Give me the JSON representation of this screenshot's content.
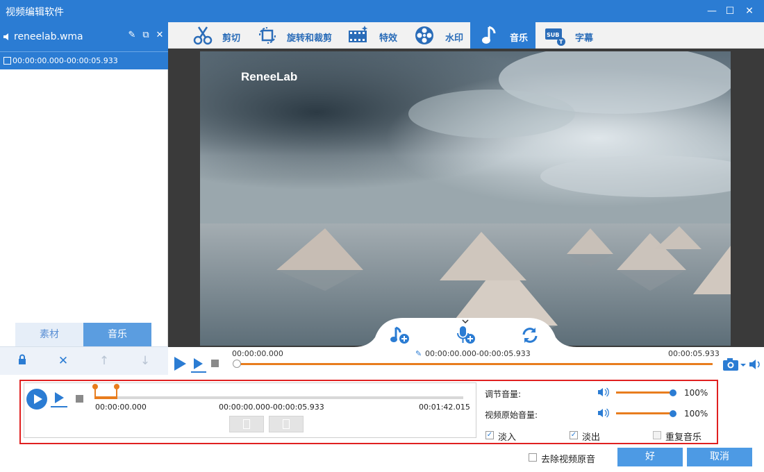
{
  "window": {
    "title": "视频编辑软件"
  },
  "left_panel": {
    "file_name": "reneelab.wma",
    "clip_range": "00:00:00.000-00:00:05.933",
    "tabs": [
      "素材",
      "音乐"
    ]
  },
  "toolbar": {
    "tabs": [
      {
        "label": "剪切",
        "icon": "scissors-icon"
      },
      {
        "label": "旋转和裁剪",
        "icon": "rotate-crop-icon"
      },
      {
        "label": "特效",
        "icon": "effects-icon"
      },
      {
        "label": "水印",
        "icon": "watermark-icon"
      },
      {
        "label": "音乐",
        "icon": "music-icon",
        "active": true
      },
      {
        "label": "字幕",
        "icon": "subtitle-icon"
      }
    ]
  },
  "preview": {
    "watermark_text": "ReneeLab",
    "timeline": {
      "start": "00:00:00.000",
      "range": "00:00:00.000-00:00:05.933",
      "end": "00:00:05.933"
    }
  },
  "music_panel": {
    "start": "00:00:00.000",
    "range": "00:00:00.000-00:00:05.933",
    "end": "00:01:42.015",
    "volume_label": "调节音量:",
    "volume_value": "100%",
    "original_volume_label": "视频原始音量:",
    "original_volume_value": "100%",
    "fade_in_label": "淡入",
    "fade_in_checked": true,
    "fade_out_label": "淡出",
    "fade_out_checked": true,
    "repeat_label": "重复音乐",
    "repeat_checked": false
  },
  "footer": {
    "remove_original_audio_label": "去除视频原音",
    "ok_label": "好",
    "cancel_label": "取消"
  },
  "colors": {
    "accent": "#2b7cd3",
    "orange": "#e87d1e",
    "highlight_box": "#e02020"
  }
}
